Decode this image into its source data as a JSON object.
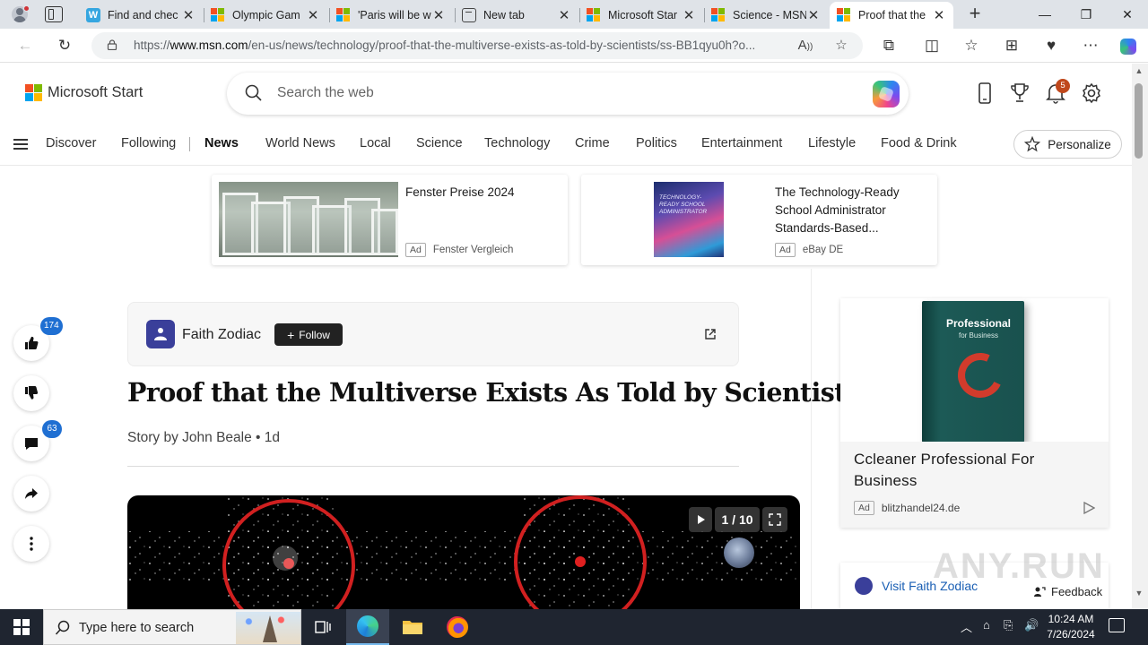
{
  "browser": {
    "tabs": [
      {
        "title": "Find and chec",
        "icon": "w-icon"
      },
      {
        "title": "Olympic Gam",
        "icon": "msn-icon"
      },
      {
        "title": "'Paris will be w",
        "icon": "msn-icon"
      },
      {
        "title": "New tab",
        "icon": "newtab-icon"
      },
      {
        "title": "Microsoft Star",
        "icon": "msn-icon"
      },
      {
        "title": "Science - MSN",
        "icon": "msn-icon"
      },
      {
        "title": "Proof that the",
        "icon": "msn-icon",
        "active": true
      }
    ],
    "url_prefix": "https://",
    "url_host": "www.msn.com",
    "url_path": "/en-us/news/technology/proof-that-the-multiverse-exists-as-told-by-scientists/ss-BB1qyu0h?o..."
  },
  "msn": {
    "brand": "Microsoft Start",
    "search_placeholder": "Search the web",
    "notification_count": "5",
    "nav": [
      "Discover",
      "Following",
      "News",
      "World News",
      "Local",
      "Science",
      "Technology",
      "Crime",
      "Politics",
      "Entertainment",
      "Lifestyle",
      "Food & Drink"
    ],
    "nav_active": "News",
    "personalize": "Personalize"
  },
  "ads": [
    {
      "title": "Fenster Preise 2024",
      "tag": "Ad",
      "source": "Fenster Vergleich"
    },
    {
      "title": "The Technology-Ready School Administrator Standards-Based...",
      "tag": "Ad",
      "source": "eBay DE",
      "image_text": "TECHNOLOGY-READY SCHOOL ADMINISTRATOR"
    }
  ],
  "engagement": {
    "likes": "174",
    "comments": "63"
  },
  "article": {
    "publisher": "Faith Zodiac",
    "follow": "Follow",
    "headline": "Proof that the Multiverse Exists As Told by Scientists",
    "byline": "Story by John Beale • 1d",
    "slide_counter": "1 / 10"
  },
  "sidebar": {
    "ad_title": "Ccleaner Professional For Business",
    "ad_tag": "Ad",
    "ad_source": "blitzhandel24.de",
    "box_title": "Professional",
    "box_subtitle": "for Business",
    "visit": "Visit Faith Zodiac",
    "feedback": "Feedback",
    "watermark": "ANY.RUN"
  },
  "taskbar": {
    "search_placeholder": "Type here to search",
    "time": "10:24 AM",
    "date": "7/26/2024"
  },
  "colors": {
    "accent": "#1f6fd2",
    "badge": "#c0481c",
    "taskbar": "#1f2530"
  }
}
